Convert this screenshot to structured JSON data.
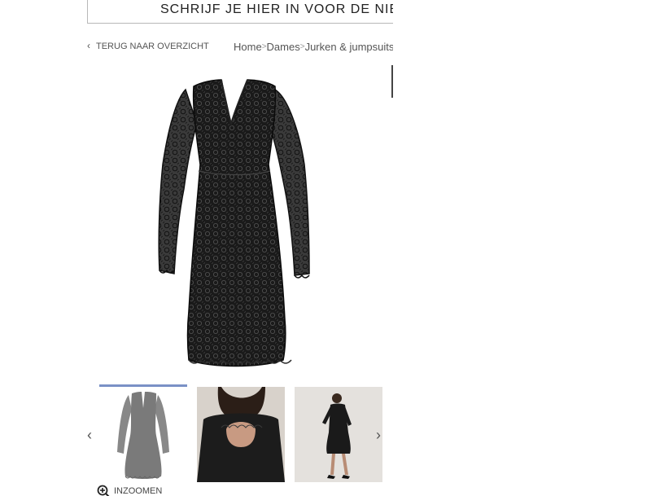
{
  "newsletter": {
    "text": "SCHRIJF JE HIER IN VOOR DE NIEUWSBRIEF"
  },
  "navigation": {
    "back_label": "TERUG NAAR OVERZICHT",
    "back_icon": "chevron-left-icon",
    "breadcrumb": [
      {
        "label": "Home"
      },
      {
        "label": "Dames"
      },
      {
        "label": "Jurken & jumpsuits"
      }
    ],
    "separator": ">"
  },
  "product": {
    "main_image": "black-lace-dress",
    "thumbnails": [
      {
        "name": "dress-front",
        "selected": true
      },
      {
        "name": "dress-back-model",
        "selected": false
      },
      {
        "name": "dress-full-model",
        "selected": false
      }
    ],
    "prev_icon": "chevron-left-icon",
    "next_icon": "chevron-right-icon",
    "zoom_label": "INZOOMEN",
    "zoom_icon": "zoom-in-icon"
  },
  "colors": {
    "selected_thumb_border": "#7a91c6",
    "dress": "#1c1c1c",
    "text": "#555555"
  }
}
